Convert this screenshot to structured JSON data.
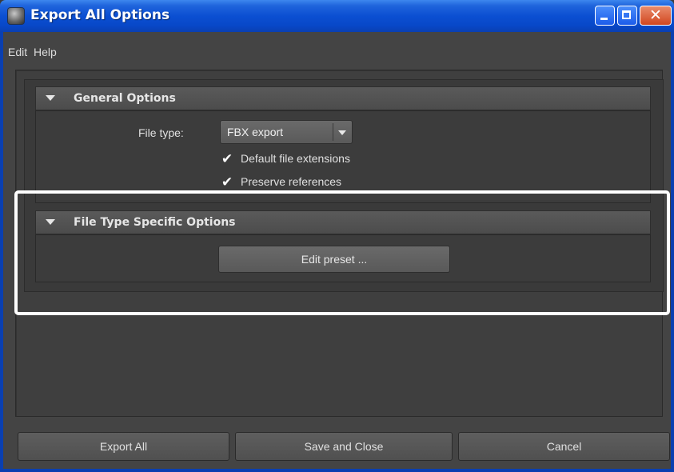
{
  "window": {
    "title": "Export All Options",
    "icon": "maya-app-icon",
    "controls": {
      "minimize": "minimize-icon",
      "maximize": "maximize-icon",
      "close": "✕"
    }
  },
  "menubar": {
    "items": [
      {
        "label": "Edit"
      },
      {
        "label": "Help"
      }
    ]
  },
  "general_options": {
    "header": "General Options",
    "file_type_label": "File type:",
    "file_type_value": "FBX export",
    "default_extensions": {
      "label": "Default file extensions",
      "checked": true,
      "mark": "✔"
    },
    "preserve_references": {
      "label": "Preserve references",
      "checked": true,
      "mark": "✔"
    }
  },
  "file_type_specific": {
    "header": "File Type Specific Options",
    "edit_preset_label": "Edit preset ..."
  },
  "buttons": {
    "export_all": "Export All",
    "save_and_close": "Save and Close",
    "cancel": "Cancel"
  },
  "colors": {
    "titlebar_blue": "#0b4fd2",
    "panel_bg": "#444444",
    "highlight_outline": "#ffffff"
  }
}
